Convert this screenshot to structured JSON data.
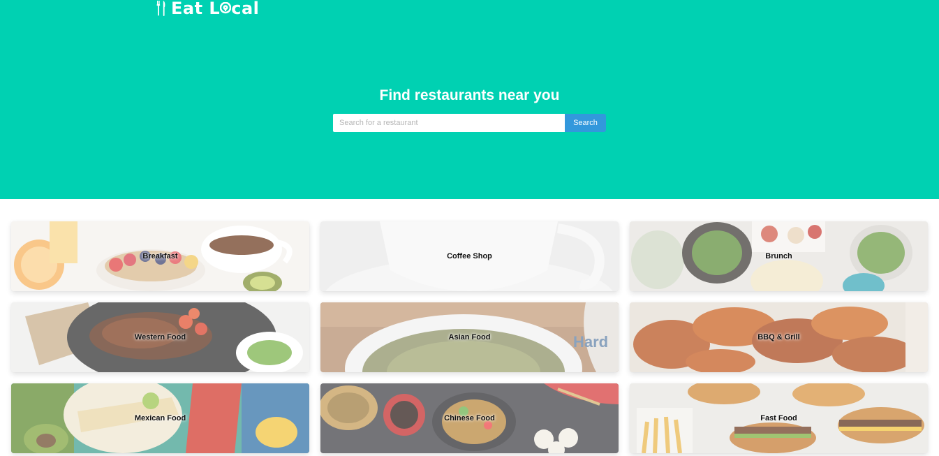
{
  "brand": {
    "name_part1": "Eat L",
    "name_part2": "cal",
    "hero_color": "#00d1b2"
  },
  "hero": {
    "title": "Find restaurants near you"
  },
  "search": {
    "placeholder": "Search for a restaurant",
    "value": "",
    "button_label": "Search",
    "button_color": "#3298dc"
  },
  "categories": [
    {
      "label": "Breakfast",
      "icon": "breakfast-image"
    },
    {
      "label": "Coffee Shop",
      "icon": "coffee-image"
    },
    {
      "label": "Brunch",
      "icon": "brunch-image"
    },
    {
      "label": "Western Food",
      "icon": "western-food-image"
    },
    {
      "label": "Asian Food",
      "icon": "asian-food-image"
    },
    {
      "label": "BBQ & Grill",
      "icon": "bbq-image"
    },
    {
      "label": "Mexican Food",
      "icon": "mexican-food-image"
    },
    {
      "label": "Chinese Food",
      "icon": "chinese-food-image"
    },
    {
      "label": "Fast Food",
      "icon": "fast-food-image"
    }
  ]
}
